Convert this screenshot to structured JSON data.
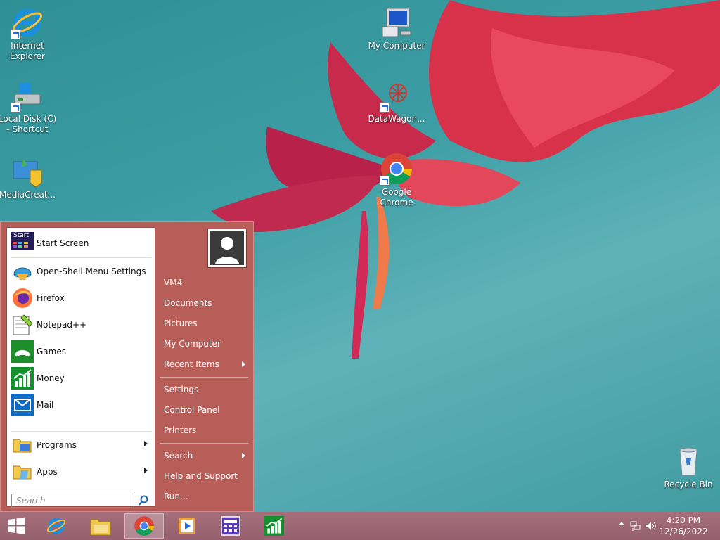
{
  "desktop": {
    "icons": [
      {
        "label": "Internet Explorer"
      },
      {
        "label": "Local Disk (C) - Shortcut"
      },
      {
        "label": "MediaCreat..."
      },
      {
        "label": "My Computer"
      },
      {
        "label": "DataWagon..."
      },
      {
        "label": "Google Chrome"
      },
      {
        "label": "Recycle Bin"
      }
    ]
  },
  "start_menu": {
    "left_items": [
      {
        "label": "Start Screen",
        "icon": "start-screen-icon"
      },
      {
        "label": "Open-Shell Menu Settings",
        "icon": "open-shell-icon"
      },
      {
        "label": "Firefox",
        "icon": "firefox-icon"
      },
      {
        "label": "Notepad++",
        "icon": "notepad-plus-plus-icon"
      },
      {
        "label": "Games",
        "icon": "games-icon"
      },
      {
        "label": "Money",
        "icon": "money-icon"
      },
      {
        "label": "Mail",
        "icon": "mail-icon"
      },
      {
        "label": "Programs",
        "icon": "programs-icon"
      },
      {
        "label": "Apps",
        "icon": "apps-icon"
      }
    ],
    "start_screen_badge": "Start",
    "search_placeholder": "Search",
    "right_items": [
      {
        "label": "VM4"
      },
      {
        "label": "Documents"
      },
      {
        "label": "Pictures"
      },
      {
        "label": "My Computer"
      },
      {
        "label": "Recent Items"
      },
      {
        "label": "Settings"
      },
      {
        "label": "Control Panel"
      },
      {
        "label": "Printers"
      },
      {
        "label": "Search"
      },
      {
        "label": "Help and Support"
      },
      {
        "label": "Run..."
      }
    ]
  },
  "taskbar": {
    "buttons": [
      {
        "icon": "windows-start-icon"
      },
      {
        "icon": "internet-explorer-icon"
      },
      {
        "icon": "file-explorer-icon"
      },
      {
        "icon": "chrome-icon"
      },
      {
        "icon": "media-player-icon"
      },
      {
        "icon": "calculator-icon"
      },
      {
        "icon": "money-icon"
      }
    ],
    "clock_time": "4:20 PM",
    "clock_date": "12/26/2022"
  },
  "colors": {
    "start_menu_bg": "#b85e58",
    "taskbar_bg": "#9c6674",
    "desktop_bg": "#3c9ea4"
  }
}
